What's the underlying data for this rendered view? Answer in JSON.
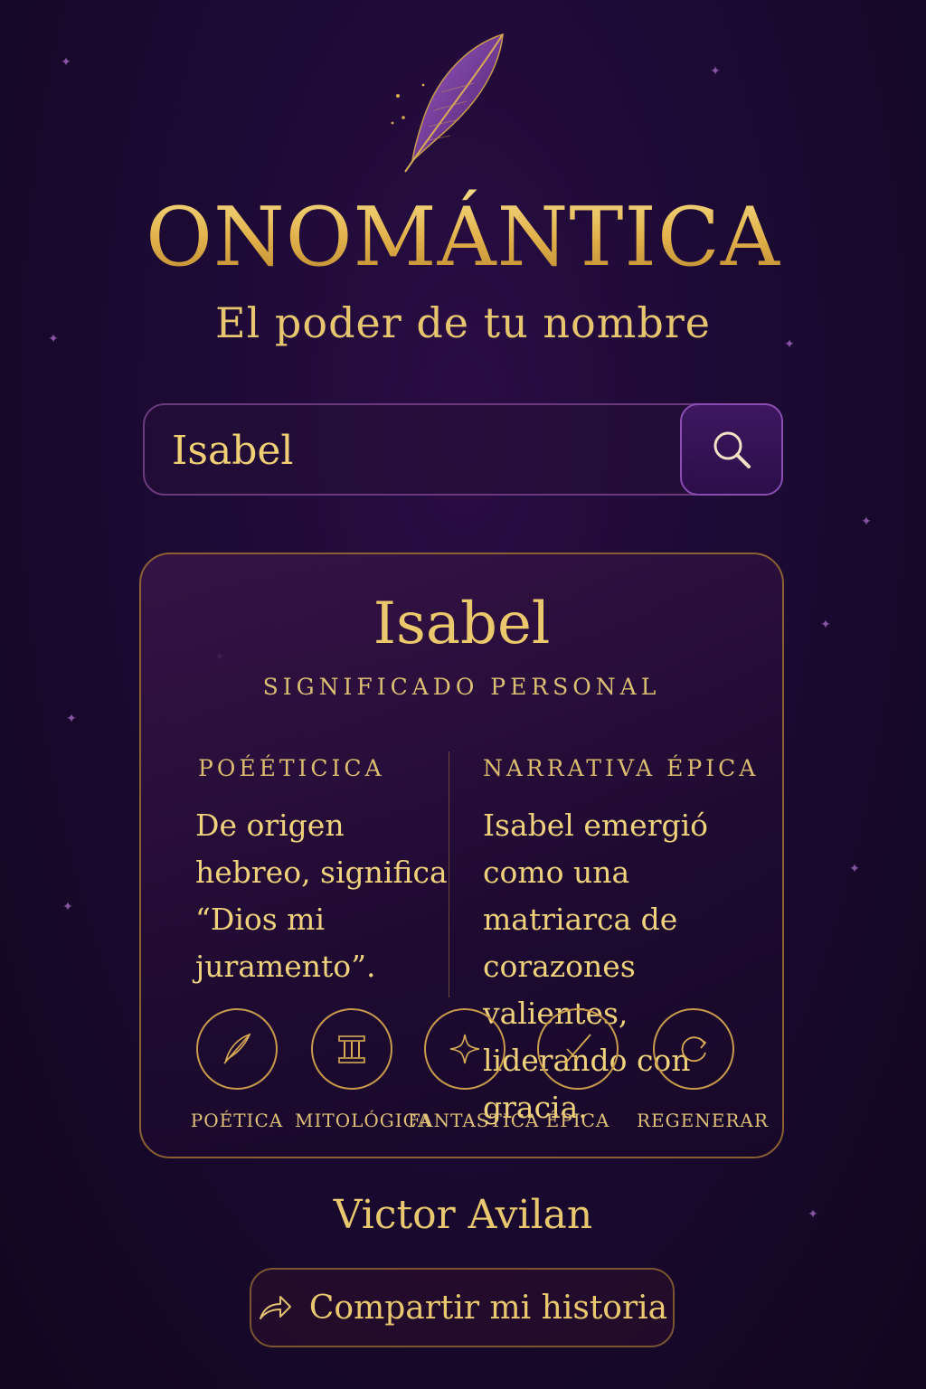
{
  "header": {
    "logo_text": "ONOMÁNTICA",
    "tagline": "El poder de tu nombre"
  },
  "search": {
    "value": "Isabel",
    "button_icon": "search-icon"
  },
  "card": {
    "name": "Isabel",
    "subtitle": "SIGNIFICADO PERSONAL",
    "columns": [
      {
        "heading": "POÉÉTICICA",
        "text": "De origen hebreo, significa “Dios mi juramento”."
      },
      {
        "heading": "NARRATIVA ÉPICA",
        "text": "Isabel emergió como una matriarca de corazones valientes, liderando con gracia."
      }
    ],
    "actions": [
      {
        "label": "POÉTICA",
        "icon": "feather-icon"
      },
      {
        "label": "MITOLÓGICA",
        "icon": "column-icon"
      },
      {
        "label": "FANTASTICA",
        "icon": "sparkle-icon"
      },
      {
        "label": "ÉPICA",
        "icon": "sword-icon"
      },
      {
        "label": "REGENERAR",
        "icon": "refresh-icon"
      }
    ]
  },
  "footer": {
    "author": "Victor Avilan",
    "share_label": "Compartir mi historia",
    "share_icon": "share-arrow-icon"
  },
  "colors": {
    "background": "#1d0a35",
    "gold": "#e6c468",
    "accent_purple": "#8a4db2"
  }
}
